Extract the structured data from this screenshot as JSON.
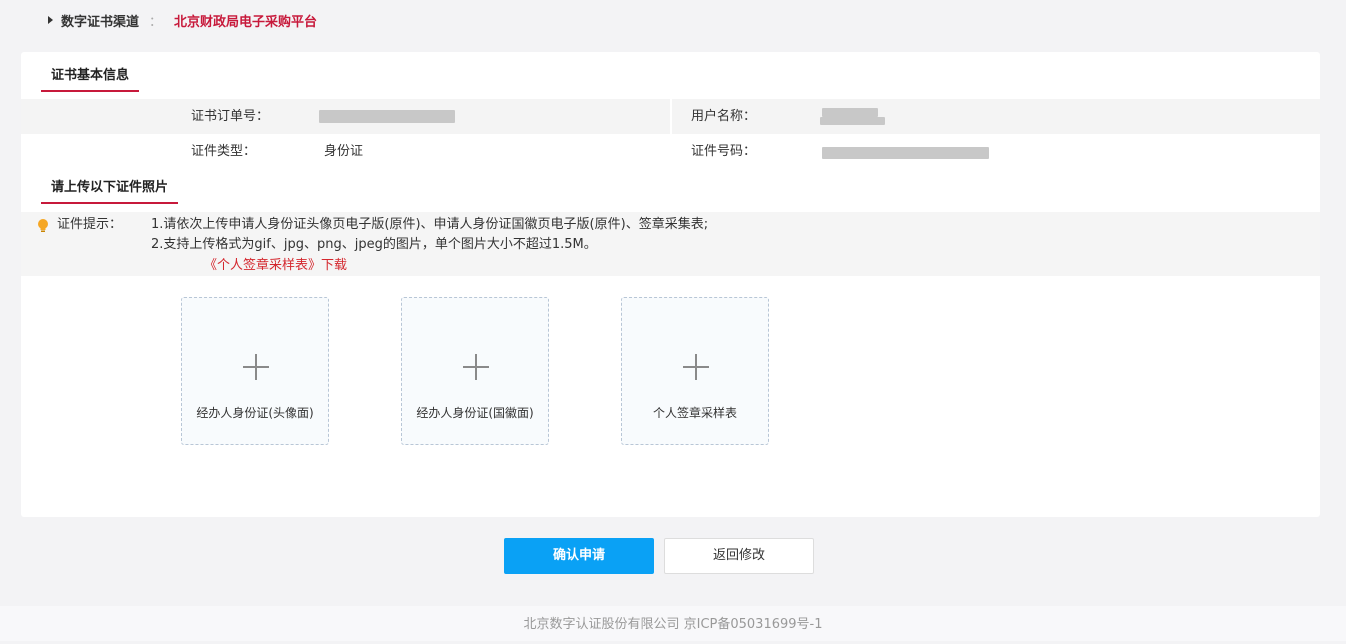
{
  "breadcrumb": {
    "label": "数字证书渠道",
    "separator": "：",
    "value": "北京财政局电子采购平台"
  },
  "sections": {
    "basic_info": "证书基本信息",
    "upload": "请上传以下证件照片"
  },
  "info": {
    "order_no_label": "证书订单号：",
    "user_name_label": "用户名称：",
    "id_type_label": "证件类型：",
    "id_type_value": "身份证",
    "id_number_label": "证件号码："
  },
  "tips": {
    "label": "证件提示：",
    "line1": "1.请依次上传申请人身份证头像页电子版(原件)、申请人身份证国徽页电子版(原件)、签章采集表;",
    "line2": "2.支持上传格式为gif、jpg、png、jpeg的图片，单个图片大小不超过1.5M。",
    "link": "《个人签章采样表》下载"
  },
  "uploads": [
    {
      "label": "经办人身份证(头像面)"
    },
    {
      "label": "经办人身份证(国徽面)"
    },
    {
      "label": "个人签章采样表"
    }
  ],
  "buttons": {
    "confirm": "确认申请",
    "back": "返回修改"
  },
  "footer": {
    "text": "北京数字认证股份有限公司 京ICP备05031699号-1"
  },
  "colors": {
    "brand_red": "#c7193b",
    "primary_blue": "#0aa1f5",
    "link_red": "#d4272e",
    "tip_icon": "#f5a623"
  },
  "icons": {
    "breadcrumb": "caret-right-icon",
    "tip": "lightbulb-icon",
    "upload": "plus-icon"
  }
}
